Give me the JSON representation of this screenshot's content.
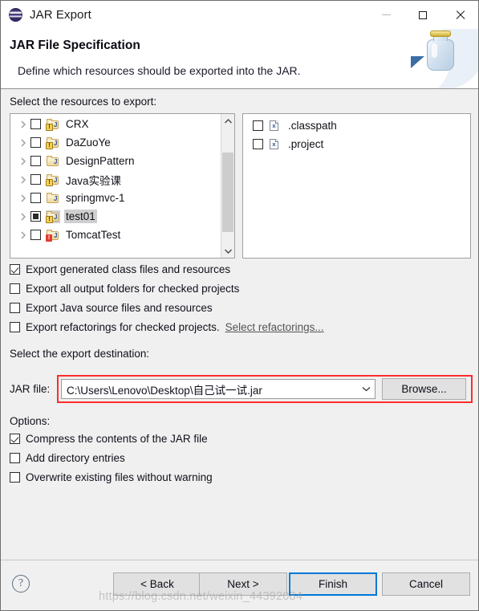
{
  "window": {
    "title": "JAR Export",
    "icon": "eclipse-icon",
    "minimize_label": "—",
    "maximize_label": "□",
    "close_label": "✕"
  },
  "header": {
    "title": "JAR File Specification",
    "description": "Define which resources should be exported into the JAR.",
    "art_icon": "jar-export-illustration"
  },
  "resources": {
    "label": "Select the resources to export:",
    "tree": [
      {
        "label": "CRX",
        "check": "unchecked",
        "icon": "project-folder-warning-icon",
        "selected": false
      },
      {
        "label": "DaZuoYe",
        "check": "unchecked",
        "icon": "project-folder-warning-icon",
        "selected": false
      },
      {
        "label": "DesignPattern",
        "check": "unchecked",
        "icon": "project-folder-icon",
        "selected": false
      },
      {
        "label": "Java实验课",
        "check": "unchecked",
        "icon": "project-folder-warning-icon",
        "selected": false
      },
      {
        "label": "springmvc-1",
        "check": "unchecked",
        "icon": "project-folder-icon",
        "selected": false
      },
      {
        "label": "test01",
        "check": "partial",
        "icon": "project-folder-warning-icon",
        "selected": true
      },
      {
        "label": "TomcatTest",
        "check": "unchecked",
        "icon": "project-folder-error-icon",
        "selected": false
      }
    ],
    "files": [
      {
        "label": ".classpath",
        "check": "unchecked",
        "icon": "xml-file-icon"
      },
      {
        "label": ".project",
        "check": "unchecked",
        "icon": "xml-file-icon"
      }
    ],
    "scrollbar": {
      "up_icon": "chevron-up-icon",
      "down_icon": "chevron-down-icon"
    }
  },
  "export_options": [
    {
      "label": "Export generated class files and resources",
      "check": "checked"
    },
    {
      "label": "Export all output folders for checked projects",
      "check": "unchecked"
    },
    {
      "label": "Export Java source files and resources",
      "check": "unchecked"
    },
    {
      "label": "Export refactorings for checked projects.",
      "check": "unchecked",
      "link": "Select refactorings..."
    }
  ],
  "destination": {
    "label": "Select the export destination:",
    "jar_file_label": "JAR file:",
    "jar_file_value": "C:\\Users\\Lenovo\\Desktop\\自己试一试.jar",
    "dropdown_icon": "chevron-down-icon",
    "browse_label": "Browse...",
    "highlight_color": "#ff2d2d"
  },
  "options": {
    "label": "Options:",
    "items": [
      {
        "label": "Compress the contents of the JAR file",
        "check": "checked"
      },
      {
        "label": "Add directory entries",
        "check": "unchecked"
      },
      {
        "label": "Overwrite existing files without warning",
        "check": "unchecked"
      }
    ]
  },
  "footer": {
    "help_icon": "help-question-icon",
    "back_label": "< Back",
    "next_label": "Next >",
    "finish_label": "Finish",
    "cancel_label": "Cancel",
    "focus_color": "#0078d7"
  },
  "watermark": "https://blog.csdn.net/weixin_44392084"
}
